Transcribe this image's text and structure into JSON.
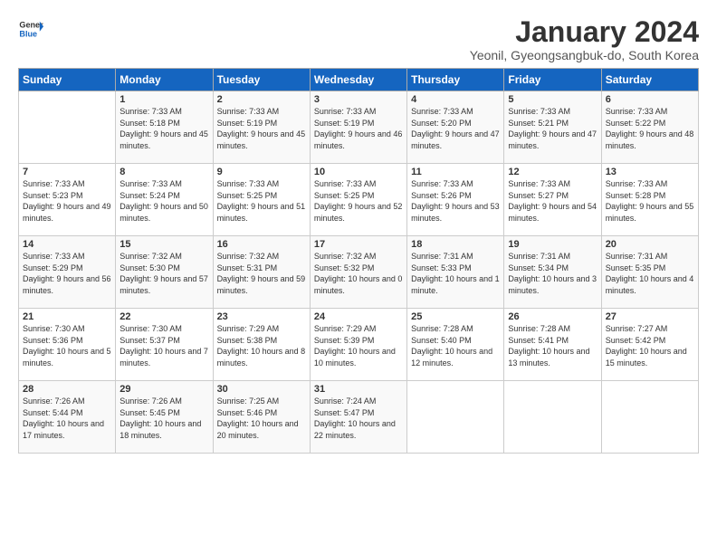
{
  "logo": {
    "line1": "General",
    "line2": "Blue"
  },
  "title": "January 2024",
  "subtitle": "Yeonil, Gyeongsangbuk-do, South Korea",
  "header": {
    "days": [
      "Sunday",
      "Monday",
      "Tuesday",
      "Wednesday",
      "Thursday",
      "Friday",
      "Saturday"
    ]
  },
  "weeks": [
    [
      {
        "num": "",
        "sunrise": "",
        "sunset": "",
        "daylight": ""
      },
      {
        "num": "1",
        "sunrise": "Sunrise: 7:33 AM",
        "sunset": "Sunset: 5:18 PM",
        "daylight": "Daylight: 9 hours and 45 minutes."
      },
      {
        "num": "2",
        "sunrise": "Sunrise: 7:33 AM",
        "sunset": "Sunset: 5:19 PM",
        "daylight": "Daylight: 9 hours and 45 minutes."
      },
      {
        "num": "3",
        "sunrise": "Sunrise: 7:33 AM",
        "sunset": "Sunset: 5:19 PM",
        "daylight": "Daylight: 9 hours and 46 minutes."
      },
      {
        "num": "4",
        "sunrise": "Sunrise: 7:33 AM",
        "sunset": "Sunset: 5:20 PM",
        "daylight": "Daylight: 9 hours and 47 minutes."
      },
      {
        "num": "5",
        "sunrise": "Sunrise: 7:33 AM",
        "sunset": "Sunset: 5:21 PM",
        "daylight": "Daylight: 9 hours and 47 minutes."
      },
      {
        "num": "6",
        "sunrise": "Sunrise: 7:33 AM",
        "sunset": "Sunset: 5:22 PM",
        "daylight": "Daylight: 9 hours and 48 minutes."
      }
    ],
    [
      {
        "num": "7",
        "sunrise": "Sunrise: 7:33 AM",
        "sunset": "Sunset: 5:23 PM",
        "daylight": "Daylight: 9 hours and 49 minutes."
      },
      {
        "num": "8",
        "sunrise": "Sunrise: 7:33 AM",
        "sunset": "Sunset: 5:24 PM",
        "daylight": "Daylight: 9 hours and 50 minutes."
      },
      {
        "num": "9",
        "sunrise": "Sunrise: 7:33 AM",
        "sunset": "Sunset: 5:25 PM",
        "daylight": "Daylight: 9 hours and 51 minutes."
      },
      {
        "num": "10",
        "sunrise": "Sunrise: 7:33 AM",
        "sunset": "Sunset: 5:25 PM",
        "daylight": "Daylight: 9 hours and 52 minutes."
      },
      {
        "num": "11",
        "sunrise": "Sunrise: 7:33 AM",
        "sunset": "Sunset: 5:26 PM",
        "daylight": "Daylight: 9 hours and 53 minutes."
      },
      {
        "num": "12",
        "sunrise": "Sunrise: 7:33 AM",
        "sunset": "Sunset: 5:27 PM",
        "daylight": "Daylight: 9 hours and 54 minutes."
      },
      {
        "num": "13",
        "sunrise": "Sunrise: 7:33 AM",
        "sunset": "Sunset: 5:28 PM",
        "daylight": "Daylight: 9 hours and 55 minutes."
      }
    ],
    [
      {
        "num": "14",
        "sunrise": "Sunrise: 7:33 AM",
        "sunset": "Sunset: 5:29 PM",
        "daylight": "Daylight: 9 hours and 56 minutes."
      },
      {
        "num": "15",
        "sunrise": "Sunrise: 7:32 AM",
        "sunset": "Sunset: 5:30 PM",
        "daylight": "Daylight: 9 hours and 57 minutes."
      },
      {
        "num": "16",
        "sunrise": "Sunrise: 7:32 AM",
        "sunset": "Sunset: 5:31 PM",
        "daylight": "Daylight: 9 hours and 59 minutes."
      },
      {
        "num": "17",
        "sunrise": "Sunrise: 7:32 AM",
        "sunset": "Sunset: 5:32 PM",
        "daylight": "Daylight: 10 hours and 0 minutes."
      },
      {
        "num": "18",
        "sunrise": "Sunrise: 7:31 AM",
        "sunset": "Sunset: 5:33 PM",
        "daylight": "Daylight: 10 hours and 1 minute."
      },
      {
        "num": "19",
        "sunrise": "Sunrise: 7:31 AM",
        "sunset": "Sunset: 5:34 PM",
        "daylight": "Daylight: 10 hours and 3 minutes."
      },
      {
        "num": "20",
        "sunrise": "Sunrise: 7:31 AM",
        "sunset": "Sunset: 5:35 PM",
        "daylight": "Daylight: 10 hours and 4 minutes."
      }
    ],
    [
      {
        "num": "21",
        "sunrise": "Sunrise: 7:30 AM",
        "sunset": "Sunset: 5:36 PM",
        "daylight": "Daylight: 10 hours and 5 minutes."
      },
      {
        "num": "22",
        "sunrise": "Sunrise: 7:30 AM",
        "sunset": "Sunset: 5:37 PM",
        "daylight": "Daylight: 10 hours and 7 minutes."
      },
      {
        "num": "23",
        "sunrise": "Sunrise: 7:29 AM",
        "sunset": "Sunset: 5:38 PM",
        "daylight": "Daylight: 10 hours and 8 minutes."
      },
      {
        "num": "24",
        "sunrise": "Sunrise: 7:29 AM",
        "sunset": "Sunset: 5:39 PM",
        "daylight": "Daylight: 10 hours and 10 minutes."
      },
      {
        "num": "25",
        "sunrise": "Sunrise: 7:28 AM",
        "sunset": "Sunset: 5:40 PM",
        "daylight": "Daylight: 10 hours and 12 minutes."
      },
      {
        "num": "26",
        "sunrise": "Sunrise: 7:28 AM",
        "sunset": "Sunset: 5:41 PM",
        "daylight": "Daylight: 10 hours and 13 minutes."
      },
      {
        "num": "27",
        "sunrise": "Sunrise: 7:27 AM",
        "sunset": "Sunset: 5:42 PM",
        "daylight": "Daylight: 10 hours and 15 minutes."
      }
    ],
    [
      {
        "num": "28",
        "sunrise": "Sunrise: 7:26 AM",
        "sunset": "Sunset: 5:44 PM",
        "daylight": "Daylight: 10 hours and 17 minutes."
      },
      {
        "num": "29",
        "sunrise": "Sunrise: 7:26 AM",
        "sunset": "Sunset: 5:45 PM",
        "daylight": "Daylight: 10 hours and 18 minutes."
      },
      {
        "num": "30",
        "sunrise": "Sunrise: 7:25 AM",
        "sunset": "Sunset: 5:46 PM",
        "daylight": "Daylight: 10 hours and 20 minutes."
      },
      {
        "num": "31",
        "sunrise": "Sunrise: 7:24 AM",
        "sunset": "Sunset: 5:47 PM",
        "daylight": "Daylight: 10 hours and 22 minutes."
      },
      {
        "num": "",
        "sunrise": "",
        "sunset": "",
        "daylight": ""
      },
      {
        "num": "",
        "sunrise": "",
        "sunset": "",
        "daylight": ""
      },
      {
        "num": "",
        "sunrise": "",
        "sunset": "",
        "daylight": ""
      }
    ]
  ]
}
